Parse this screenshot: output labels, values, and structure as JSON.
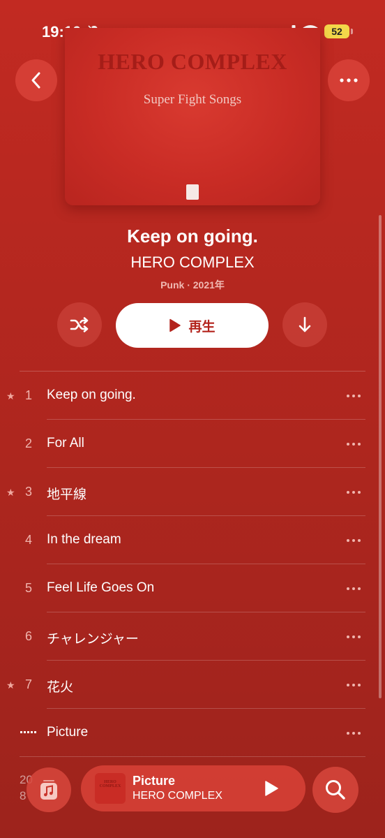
{
  "status_bar": {
    "time": "19:10",
    "battery": "52"
  },
  "album": {
    "artwork_title": "HERO COMPLEX",
    "artwork_subtitle": "Super Fight Songs",
    "title": "Keep on going.",
    "artist": "HERO COMPLEX",
    "meta": "Punk · 2021年"
  },
  "actions": {
    "play_label": "再生"
  },
  "tracks": [
    {
      "num": "1",
      "title": "Keep on going.",
      "favorite": true
    },
    {
      "num": "2",
      "title": "For All",
      "favorite": false
    },
    {
      "num": "3",
      "title": "地平線",
      "favorite": true
    },
    {
      "num": "4",
      "title": "In the dream",
      "favorite": false
    },
    {
      "num": "5",
      "title": "Feel Life Goes On",
      "favorite": false
    },
    {
      "num": "6",
      "title": "チャレンジャー",
      "favorite": false
    },
    {
      "num": "7",
      "title": "花火",
      "favorite": true
    },
    {
      "num": "",
      "title": "Picture",
      "favorite": false,
      "now_playing": true
    }
  ],
  "footer": {
    "line1": "20",
    "line2": "8"
  },
  "mini_player": {
    "title": "Picture",
    "artist": "HERO COMPLEX"
  },
  "colors": {
    "background": "#b4271f",
    "accent": "#b3231c",
    "battery": "#f3d74a"
  }
}
